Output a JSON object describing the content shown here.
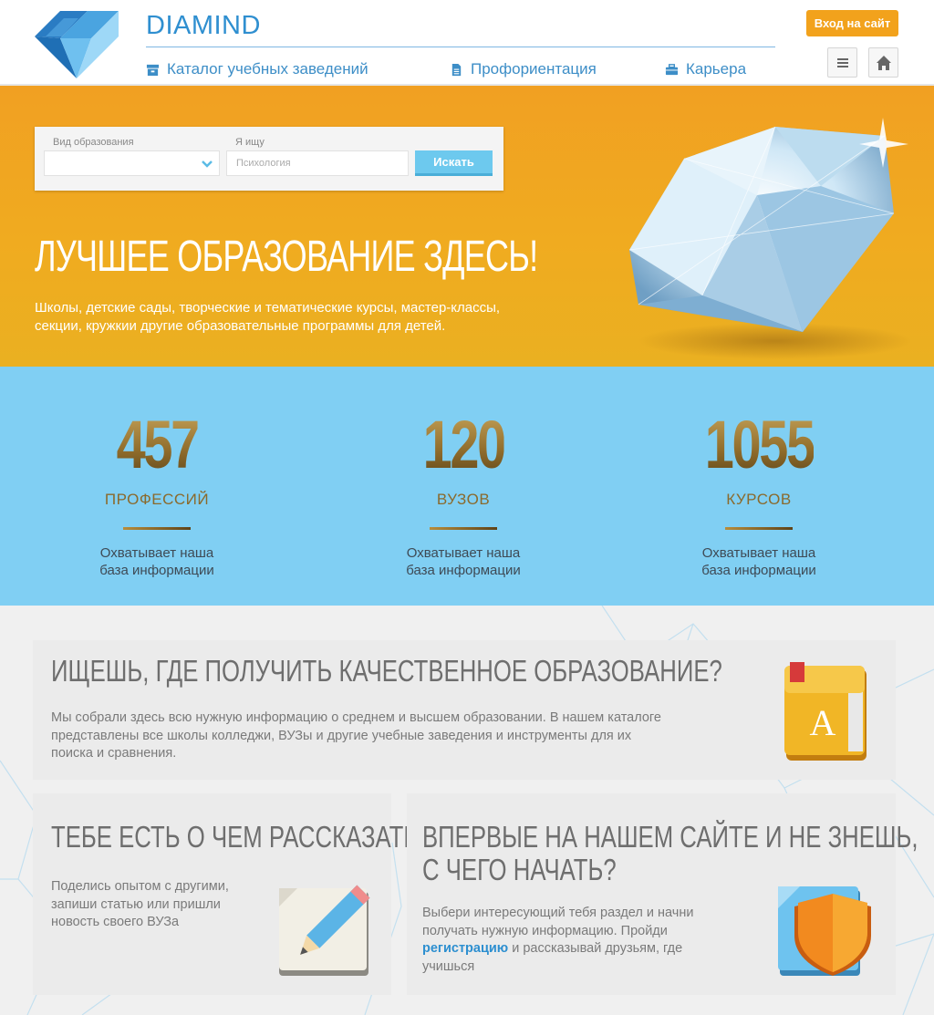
{
  "header": {
    "brand": "DIAMIND",
    "login_label": "Вход на сайт",
    "nav": [
      {
        "label": "Каталог учебных заведений",
        "icon": "archive-icon"
      },
      {
        "label": "Профориентация",
        "icon": "document-icon"
      },
      {
        "label": "Карьера",
        "icon": "briefcase-icon"
      }
    ],
    "menu_icon": "menu-icon",
    "home_icon": "home-icon",
    "accent_color": "#f2a21c",
    "brand_color": "#2f8fd0"
  },
  "search": {
    "type_label": "Вид образования",
    "type_value": "",
    "query_label": "Я ищу",
    "query_placeholder": "Психология",
    "button_label": "Искать"
  },
  "hero": {
    "title": "ЛУЧШЕЕ ОБРАЗОВАНИЕ ЗДЕСЬ!",
    "subtitle": "Школы, детские сады, творческие и тематические курсы, мастер-классы, секции, кружкии другие образовательные программы для детей."
  },
  "stats": [
    {
      "number": "457",
      "label": "ПРОФЕССИЙ",
      "desc1": "Охватывает наша",
      "desc2": "база информации"
    },
    {
      "number": "120",
      "label": "ВУЗОВ",
      "desc1": "Охватывает наша",
      "desc2": "база информации"
    },
    {
      "number": "1055",
      "label": "КУРСОВ",
      "desc1": "Охватывает наша",
      "desc2": "база информации"
    }
  ],
  "cards": {
    "education": {
      "title": "ИЩЕШЬ, ГДЕ ПОЛУЧИТЬ КАЧЕСТВЕННОЕ ОБРАЗОВАНИЕ?",
      "text": "Мы собрали здесь всю нужную информацию о среднем и высшем образовании. В нашем каталоге представлены все школы колледжи, ВУЗы и другие учебные заведения и инструменты для их поиска и сравнения.",
      "icon": "book-icon",
      "icon_letter": "A"
    },
    "story": {
      "title": "ТЕБЕ ЕСТЬ О ЧЕМ РАССКАЗАТЬ?",
      "text": "Поделись опытом с другими, запиши статью или пришли новость своего ВУЗа",
      "icon": "pencil-icon"
    },
    "newcomer": {
      "title_line1": "ВПЕРВЫЕ НА НАШЕМ САЙТЕ  И НЕ ЗНЕШЬ,",
      "title_line2": "С ЧЕГО НАЧАТЬ?",
      "text_before": "Выбери интересующий тебя раздел и начни получать нужную информацию. Пройди",
      "link": "регистрацию",
      "text_after": "и рассказывай друзьям, где учишься",
      "icon": "shield-icon"
    }
  }
}
